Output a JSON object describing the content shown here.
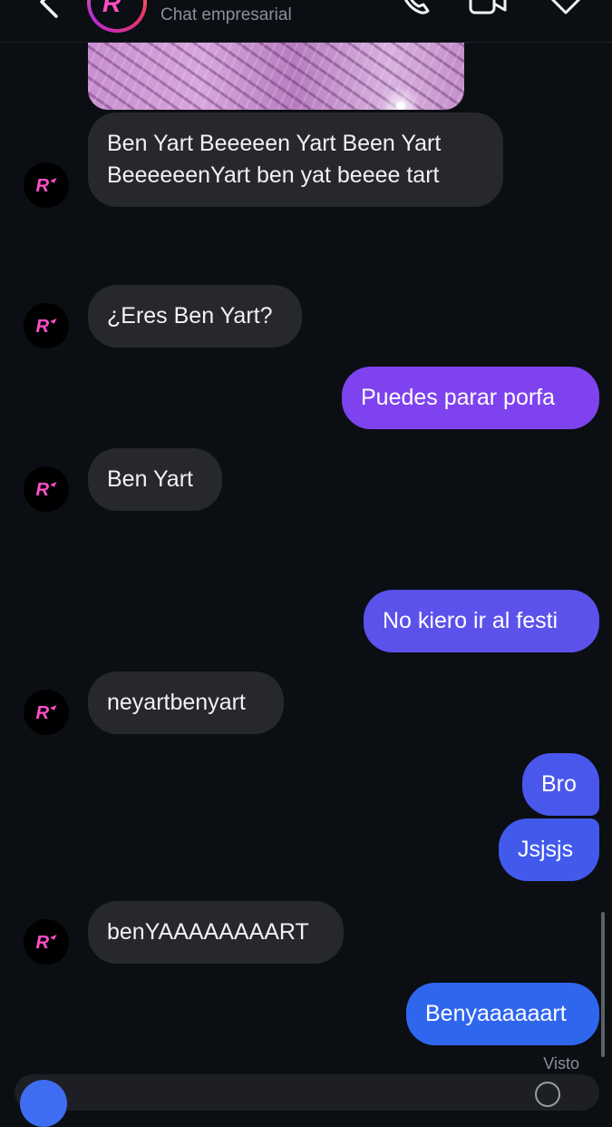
{
  "header": {
    "subtitle": "Chat empresarial",
    "icons": {
      "back": "chevron-left-icon",
      "call": "phone-icon",
      "video": "video-camera-icon",
      "tag": "tag-icon"
    }
  },
  "messages": [
    {
      "side": "in",
      "lines": [
        "Ben Yart Beeeeen Yart Been Yart",
        "BeeeeeenYart ben yat beeee tart"
      ]
    },
    {
      "side": "in",
      "lines": [
        "¿Eres Ben Yart?"
      ]
    },
    {
      "side": "out",
      "lines": [
        "Puedes parar porfa"
      ]
    },
    {
      "side": "in",
      "lines": [
        "Ben Yart"
      ]
    },
    {
      "side": "out",
      "lines": [
        "No kiero ir al festi"
      ]
    },
    {
      "side": "in",
      "lines": [
        "neyartbenyart"
      ]
    },
    {
      "side": "out",
      "lines": [
        "Bro"
      ]
    },
    {
      "side": "out",
      "lines": [
        "Jsjsjs"
      ]
    },
    {
      "side": "in",
      "lines": [
        "benYAAAAAAAART"
      ]
    },
    {
      "side": "out",
      "lines": [
        "Benyaaaaaart"
      ]
    }
  ],
  "seen_label": "Visto",
  "colors": {
    "background": "#0b0e13",
    "incoming_bubble": "#26282d",
    "outgoing_purple": "#7e43ee",
    "outgoing_blue": "#2f66ee",
    "avatar_logo": "#ff4fc8"
  }
}
